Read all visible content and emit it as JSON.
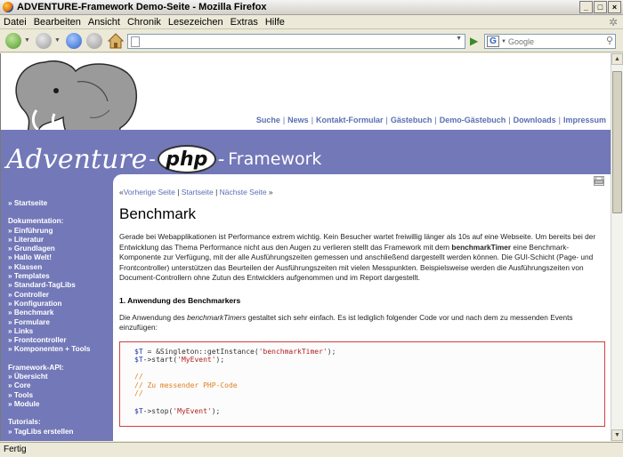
{
  "window": {
    "title": "ADVENTURE-Framework Demo-Seite - Mozilla Firefox"
  },
  "menubar": {
    "items": [
      "Datei",
      "Bearbeiten",
      "Ansicht",
      "Chronik",
      "Lesezeichen",
      "Extras",
      "Hilfe"
    ]
  },
  "navbar": {
    "url": "",
    "search_placeholder": "Google",
    "search_engine": "G"
  },
  "site": {
    "top_links": [
      "Suche",
      "News",
      "Kontakt-Formular",
      "Gästebuch",
      "Demo-Gästebuch",
      "Downloads",
      "Impressum"
    ],
    "logo": {
      "left": "Adventure",
      "dash1": "-",
      "php": "php",
      "dash2": "-",
      "right": "Framework"
    }
  },
  "sidebar": {
    "startseite": "» Startseite",
    "doku_heading": "Dokumentation:",
    "doku_items": [
      "» Einführung",
      "» Literatur",
      "» Grundlagen",
      "» Hallo Welt!",
      "» Klassen",
      "» Templates",
      "» Standard-TagLibs",
      "» Controller",
      "» Konfiguration",
      "» Benchmark",
      "» Formulare",
      "» Links",
      "» Frontcontroller",
      "» Komponenten + Tools"
    ],
    "api_heading": "Framework-API:",
    "api_items": [
      "» Übersicht",
      "» Core",
      "» Tools",
      "» Module"
    ],
    "tut_heading": "Tutorials:",
    "tut_items": [
      "» TagLibs erstellen"
    ]
  },
  "main": {
    "breadcrumb": {
      "prefix": "«",
      "prev": "Vorherige Seite",
      "sep1": " | ",
      "start": "Startseite",
      "sep2": " | ",
      "next": "Nächste Seite",
      "suffix": " »"
    },
    "title": "Benchmark",
    "intro_1": "Gerade bei Webapplikationen ist Performance extrem wichtig. Kein Besucher wartet freiwillig länger als 10s auf eine Webseite. Um bereits bei der Entwicklung das Thema Performance nicht aus den Augen zu verlieren stellt das Framework mit dem ",
    "intro_bold": "benchmarkTimer",
    "intro_2": " eine Benchmark-Komponente zur Verfügung, mit der alle Ausführungszeiten gemessen und anschließend dargestellt werden können. Die GUI-Schicht (Page- und Frontcontroller) unterstützen das Beurteilen der Ausführungszeiten mit vielen Messpunkten. Beispielsweise werden die Ausführungszeiten von Document-Controllern ohne Zutun des Entwicklers aufgenommen und im Report dargestellt.",
    "section1": "1. Anwendung des Benchmarkers",
    "usage_1": "Die Anwendung des ",
    "usage_italic": "benchmarkTimers",
    "usage_2": " gestaltet sich sehr einfach. Es ist lediglich folgender Code vor und nach dem zu messenden Events einzufügen:",
    "code": {
      "l1_var": "$T",
      "l1_op": " = &Singleton::getInstance(",
      "l1_str": "'benchmarkTimer'",
      "l1_end": ");",
      "l2_var": "$T",
      "l2_op": "->start(",
      "l2_str": "'MyEvent'",
      "l2_end": ");",
      "c1": "//",
      "c2": "// Zu messender PHP-Code",
      "c3": "//",
      "l3_var": "$T",
      "l3_op": "->stop(",
      "l3_str": "'MyEvent'",
      "l3_end": ");"
    }
  },
  "status": {
    "text": "Fertig"
  }
}
